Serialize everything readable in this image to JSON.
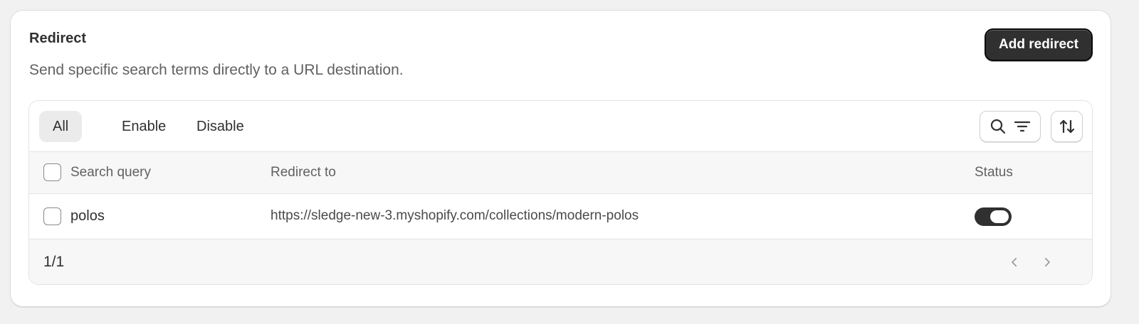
{
  "section": {
    "title": "Redirect",
    "description": "Send specific search terms directly to a URL destination.",
    "add_button_label": "Add redirect"
  },
  "tabs": [
    {
      "label": "All",
      "active": true
    },
    {
      "label": "Enable",
      "active": false
    },
    {
      "label": "Disable",
      "active": false
    }
  ],
  "toolbar": {
    "search_icon": "search-icon",
    "filter_icon": "filter-icon",
    "sort_icon": "sort-icon"
  },
  "table": {
    "columns": [
      "Search query",
      "Redirect to",
      "Status"
    ],
    "rows": [
      {
        "query": "polos",
        "redirect": "https://sledge-new-3.myshopify.com/collections/modern-polos",
        "enabled": true,
        "selected": false
      }
    ]
  },
  "pagination": {
    "label": "1/1",
    "prev_icon": "chevron-left-icon",
    "next_icon": "chevron-right-icon"
  },
  "colors": {
    "primary": "#303030",
    "background": "#f1f1f1",
    "surface": "#ffffff",
    "toggle_on": "#303030"
  }
}
